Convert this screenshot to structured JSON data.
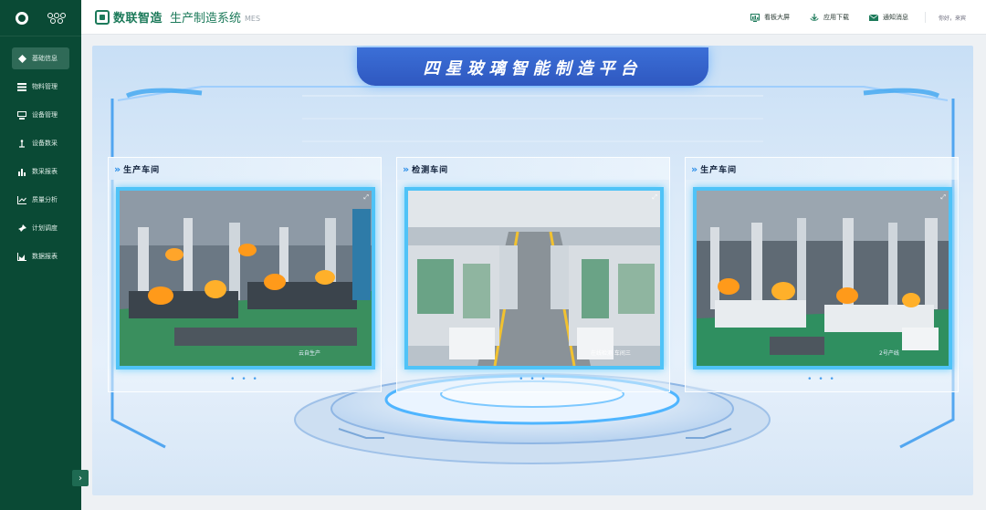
{
  "header": {
    "brand_name": "数联智造",
    "system_name": "生产制造系统",
    "system_tag": "MES",
    "actions": [
      {
        "label": "看板大屏",
        "icon": "dashboard-icon"
      },
      {
        "label": "应用下载",
        "icon": "download-icon"
      },
      {
        "label": "通知消息",
        "icon": "mail-icon"
      }
    ],
    "greeting": "你好，来宾"
  },
  "sidebar": {
    "items": [
      {
        "label": "基础信息",
        "icon": "diamond-icon",
        "active": true
      },
      {
        "label": "物料管理",
        "icon": "layers-icon"
      },
      {
        "label": "设备管理",
        "icon": "device-icon"
      },
      {
        "label": "设备数采",
        "icon": "antenna-icon"
      },
      {
        "label": "数采报表",
        "icon": "bar-chart-icon"
      },
      {
        "label": "质量分析",
        "icon": "trend-icon"
      },
      {
        "label": "计划调度",
        "icon": "pin-icon"
      },
      {
        "label": "数据报表",
        "icon": "report-icon"
      }
    ],
    "collapse_label": "›"
  },
  "main": {
    "title": "四星玻璃智能制造平台",
    "panels": [
      {
        "title": "生产车间",
        "caption": "云自生产",
        "dots": "• • •"
      },
      {
        "title": "检测车间",
        "caption": "在线检测 车间三",
        "dots": "• • •"
      },
      {
        "title": "生产车间",
        "caption": "2号产线",
        "dots": "• • •"
      }
    ]
  },
  "colors": {
    "sidebar_bg": "#0a4a35",
    "brand_green": "#1c7a5a",
    "accent_blue": "#3f8ff0",
    "video_border": "#4fc3f7"
  }
}
